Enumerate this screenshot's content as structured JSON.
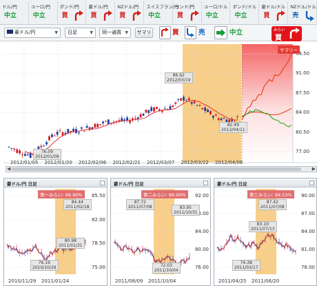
{
  "topbar": {
    "tabs": [
      {
        "name": "ドル/円",
        "action": "中立",
        "kind": "neu",
        "arrow": "none"
      },
      {
        "name": "ユーロ/円",
        "action": "中立",
        "kind": "neu",
        "arrow": "none"
      },
      {
        "name": "ポンド/円",
        "action": "買",
        "kind": "buy",
        "arrow": "up"
      },
      {
        "name": "豪ドル/円",
        "action": "買",
        "kind": "buy",
        "arrow": "up"
      },
      {
        "name": "NZドル/円",
        "action": "買",
        "kind": "buy",
        "arrow": "up"
      },
      {
        "name": "スイスフラン/円",
        "action": "中立",
        "kind": "neu",
        "arrow": "none"
      },
      {
        "name": "ランド/円",
        "action": "買",
        "kind": "buy",
        "arrow": "up"
      },
      {
        "name": "ユーロ/ドル",
        "action": "中立",
        "kind": "neu",
        "arrow": "none"
      },
      {
        "name": "ポンド/ドル",
        "action": "中立",
        "kind": "neu",
        "arrow": "none"
      },
      {
        "name": "豪ドル/ドル",
        "action": "買",
        "kind": "buy",
        "arrow": "up"
      },
      {
        "name": "NZドル/ドル",
        "action": "売",
        "kind": "sell",
        "arrow": "down"
      }
    ]
  },
  "controls": {
    "pair_select": "豪ドル/円",
    "period_select": "日足",
    "mode_select": "同一通貨",
    "summary_button": "サマリ",
    "signal_buy": "買",
    "signal_sell": "売",
    "signal_neutral": "中立",
    "mirai_small": "みらい",
    "mirai_big": "買"
  },
  "main_chart": {
    "y_ticks": [
      "94.50",
      "91.00",
      "87.50",
      "84.00",
      "80.50",
      "77.00"
    ],
    "x_ticks": [
      "2012/01/05",
      "2012/01/20",
      "2012/02/06",
      "2012/02/21",
      "2012/03/07",
      "2012/03/22",
      "2012/04/06"
    ],
    "callouts": [
      {
        "value": "86.62",
        "date": "2012/03/19"
      },
      {
        "value": "76.09",
        "date": "2012/01/09"
      },
      {
        "value": "82.49",
        "date": "2012/04/11"
      }
    ],
    "summary_label": "サマリー"
  },
  "panels": [
    {
      "title": "豪ドル/円 日足",
      "badge": "第一みらい: 99.90%",
      "y_ticks": [
        "85.50",
        "82.00",
        "78.50",
        "75.00"
      ],
      "x_ticks": [
        "2010/11/29",
        "2011/01/24"
      ],
      "callouts": [
        {
          "value": "84.44",
          "date": "2011/02/18"
        },
        {
          "value": "80.98",
          "date": "2011/01/31"
        },
        {
          "value": "76.19",
          "date": "2010/10/29"
        }
      ]
    },
    {
      "title": "豪ドル/円 日足",
      "badge": "第二みらい: 99.90%",
      "y_ticks": [
        "92.00",
        "88.00",
        "84.00",
        "80.00",
        "76.00"
      ],
      "x_ticks": [
        "2011/08/09",
        "2011/10/04"
      ],
      "callouts": [
        {
          "value": "87.72",
          "date": "2011/07/08"
        },
        {
          "value": "83.95",
          "date": "2011/10/31"
        },
        {
          "value": "72.03",
          "date": "2011/10/04"
        }
      ]
    },
    {
      "title": "豪ドル/円 日足",
      "badge": "第三みらい: 99.53%",
      "y_ticks": [
        "90.00",
        "87.00",
        "84.00",
        "81.00",
        "78.00"
      ],
      "x_ticks": [
        "2011/04/25",
        "2011/06/20"
      ],
      "callouts": [
        {
          "value": "87.42",
          "date": "2011/07/08"
        },
        {
          "value": "83.10",
          "date": "2011/07/13"
        },
        {
          "value": "74.38",
          "date": "2011/03/17"
        }
      ]
    }
  ],
  "colors": {
    "up_candle": "#1f3f9e",
    "down_candle": "#d42020",
    "ma_line": "#e02020",
    "highlight": "#f7cf8b",
    "forecast_red": "#e63a12",
    "forecast_green": "#2aaa2a",
    "buy_red": "#d0211b",
    "sell_blue": "#1565b8",
    "neutral_green": "#1a9c3a"
  }
}
